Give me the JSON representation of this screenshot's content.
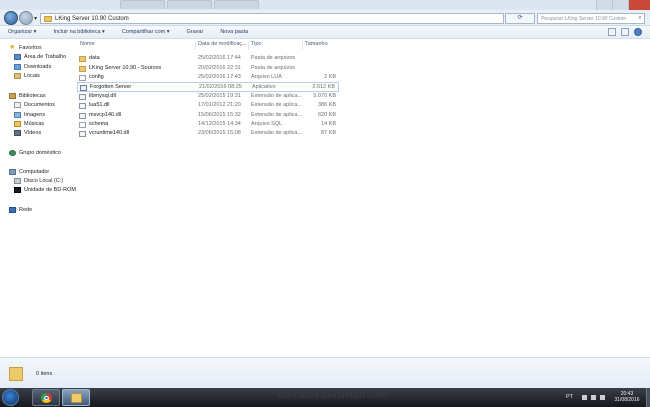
{
  "window": {
    "address_path": "LKing Server 10.90 Custom",
    "search_placeholder": "Pesquisar LKing Server 10.90 Custom"
  },
  "command_bar": {
    "items": [
      "Organizar ▾",
      "Incluir na biblioteca ▾",
      "Compartilhar com ▾",
      "Gravar",
      "Nova pasta"
    ]
  },
  "sidebar": {
    "favorites_label": "Favoritos",
    "favorites": [
      "Área de Trabalho",
      "Downloads",
      "Locais"
    ],
    "libraries_label": "Bibliotecas",
    "libraries": [
      "Documentos",
      "Imagens",
      "Músicas",
      "Vídeos"
    ],
    "homegroup_label": "Grupo doméstico",
    "computer_label": "Computador",
    "drives": [
      "Disco Local (C:)",
      "Unidade de BD-ROM"
    ],
    "network_label": "Rede"
  },
  "columns": {
    "name": "Nome",
    "date": "Data de modificaç...",
    "type": "Tipo",
    "size": "Tamanho"
  },
  "files": [
    {
      "name": "data",
      "date": "25/02/2016 17:44",
      "type": "Pasta de arquivos",
      "size": "",
      "icon": "folder"
    },
    {
      "name": "LKing Server 10.90 - Sources",
      "date": "20/02/2016 22:31",
      "type": "Pasta de arquivos",
      "size": "",
      "icon": "folder"
    },
    {
      "name": "config",
      "date": "25/02/2016 17:43",
      "type": "Arquivo LUA",
      "size": "2 KB",
      "icon": "file"
    },
    {
      "name": "Forgotten Server",
      "date": "21/02/2016 08:25",
      "type": "Aplicativo",
      "size": "2.612 KB",
      "icon": "app"
    },
    {
      "name": "libmysql.dll",
      "date": "25/02/2015 19:31",
      "type": "Extensão de aplica...",
      "size": "5.070 KB",
      "icon": "dll"
    },
    {
      "name": "lua51.dll",
      "date": "17/01/2012 21:20",
      "type": "Extensão de aplica...",
      "size": "386 KB",
      "icon": "dll"
    },
    {
      "name": "msvcp140.dll",
      "date": "15/06/2015 15:32",
      "type": "Extensão de aplica...",
      "size": "620 KB",
      "icon": "dll"
    },
    {
      "name": "schema",
      "date": "14/12/2015 14:34",
      "type": "Arquivo SQL",
      "size": "14 KB",
      "icon": "file"
    },
    {
      "name": "vcruntime140.dll",
      "date": "23/06/2015 15:08",
      "type": "Extensão de aplica...",
      "size": "87 KB",
      "icon": "dll"
    }
  ],
  "details": {
    "item_count": "0 itens"
  },
  "taskbar": {
    "watermark": "ssamaxuy.deviantart.com",
    "language": "PT",
    "time": "20:43",
    "date": "31/08/2016"
  }
}
